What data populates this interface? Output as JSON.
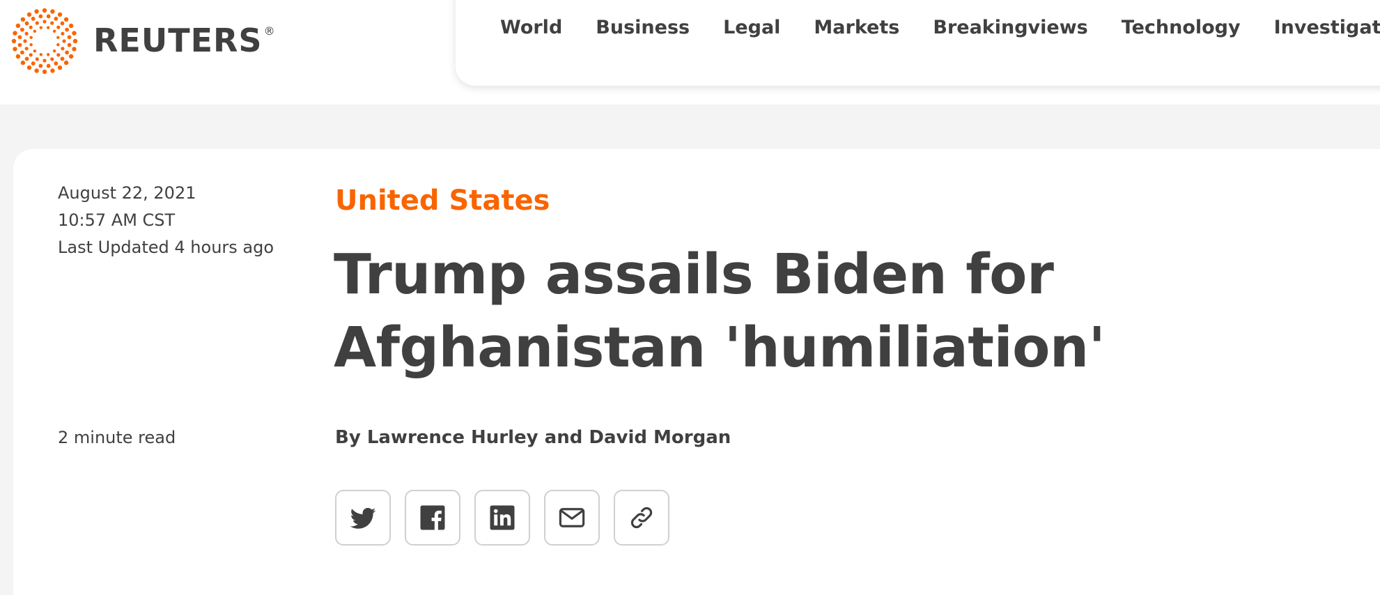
{
  "brand": {
    "name": "REUTERS",
    "registered_mark": "®",
    "accent_color": "#fa6400",
    "logo_icon": "reuters-dot-ring-icon"
  },
  "nav": {
    "items": [
      {
        "label": "World"
      },
      {
        "label": "Business"
      },
      {
        "label": "Legal"
      },
      {
        "label": "Markets"
      },
      {
        "label": "Breakingviews"
      },
      {
        "label": "Technology"
      },
      {
        "label": "Investigations"
      }
    ]
  },
  "article": {
    "date": "August 22, 2021",
    "time": "10:57 AM CST",
    "updated": "Last Updated 4 hours ago",
    "read_time": "2 minute read",
    "section": "United States",
    "headline": "Trump assails Biden for Afghanistan 'humiliation'",
    "byline": "By Lawrence Hurley and David Morgan"
  },
  "share": {
    "buttons": [
      {
        "icon": "twitter-icon"
      },
      {
        "icon": "facebook-icon"
      },
      {
        "icon": "linkedin-icon"
      },
      {
        "icon": "email-icon"
      },
      {
        "icon": "link-icon"
      }
    ]
  }
}
